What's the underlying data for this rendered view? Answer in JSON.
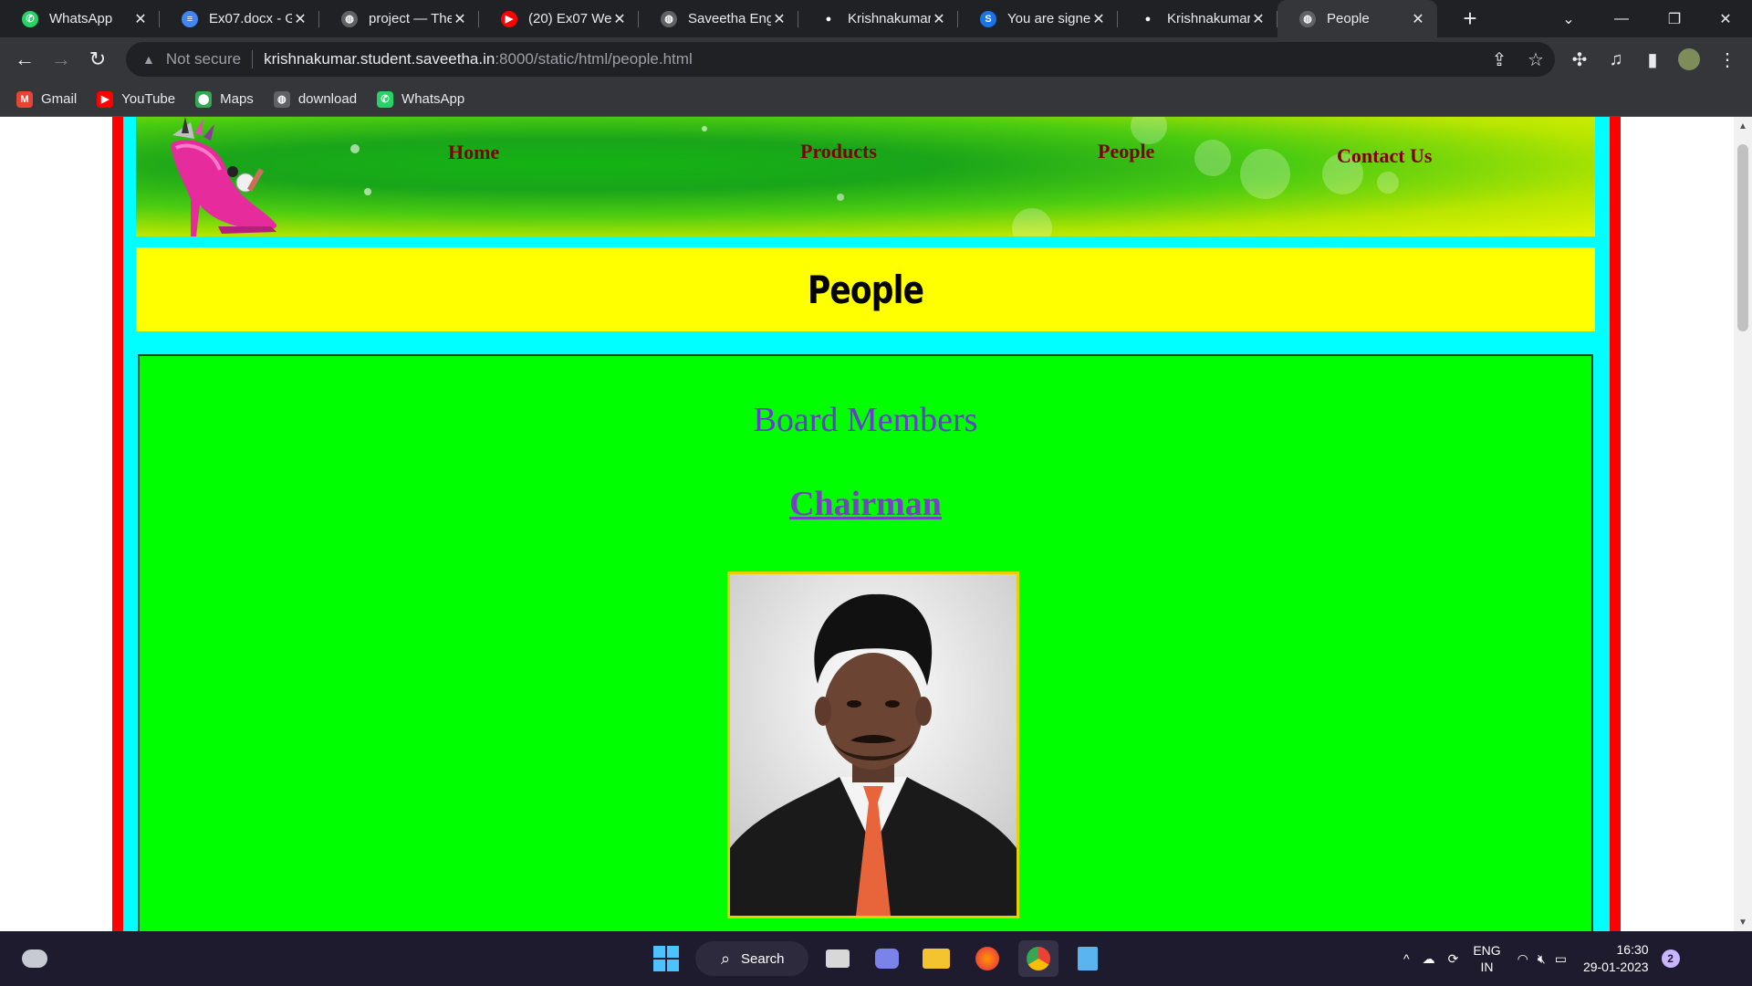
{
  "tabs": [
    {
      "title": "WhatsApp",
      "icon": "whatsapp-icon",
      "color": "#25d366",
      "glyph": "✆"
    },
    {
      "title": "Ex07.docx - Go",
      "icon": "google-docs-icon",
      "color": "#4285f4",
      "glyph": "≡"
    },
    {
      "title": "project — The",
      "icon": "globe-icon",
      "color": "#5f6368",
      "glyph": "◍"
    },
    {
      "title": "(20) Ex07 Web",
      "icon": "youtube-icon",
      "color": "#ff0000",
      "glyph": "▶"
    },
    {
      "title": "Saveetha Engi",
      "icon": "globe-icon",
      "color": "#5f6368",
      "glyph": "◍"
    },
    {
      "title": "Krishnakumar",
      "icon": "github-icon",
      "color": "#202124",
      "glyph": "●"
    },
    {
      "title": "You are signed",
      "icon": "s-app-icon",
      "color": "#1a73e8",
      "glyph": "S"
    },
    {
      "title": "Krishnakumar",
      "icon": "github-icon",
      "color": "#202124",
      "glyph": "●"
    },
    {
      "title": "People",
      "icon": "globe-icon",
      "color": "#5f6368",
      "glyph": "◍",
      "active": true
    }
  ],
  "address": {
    "security_label": "Not secure",
    "host": "krishnakumar.student.saveetha.in",
    "path": ":8000/static/html/people.html"
  },
  "bookmarks": [
    {
      "label": "Gmail",
      "icon": "gmail-icon",
      "color": "#ea4335",
      "glyph": "M"
    },
    {
      "label": "YouTube",
      "icon": "youtube-icon",
      "color": "#ff0000",
      "glyph": "▶"
    },
    {
      "label": "Maps",
      "icon": "maps-icon",
      "color": "#34a853",
      "glyph": "⬤"
    },
    {
      "label": "download",
      "icon": "globe-icon",
      "color": "#5f6368",
      "glyph": "◍"
    },
    {
      "label": "WhatsApp",
      "icon": "whatsapp-icon",
      "color": "#25d366",
      "glyph": "✆"
    }
  ],
  "site": {
    "nav": {
      "home": "Home",
      "products": "Products",
      "people": "People",
      "contact": "Contact Us"
    },
    "page_title": "People",
    "section_title": "Board Members",
    "role_title": "Chairman"
  },
  "taskbar": {
    "search_label": "Search",
    "lang_top": "ENG",
    "lang_bottom": "IN",
    "time": "16:30",
    "date": "29-01-2023",
    "notification_count": "2"
  },
  "colors": {
    "frame_red": "#ff0000",
    "frame_cyan": "#00ffff",
    "title_bg": "#ffff00",
    "content_bg": "#00ff00",
    "nav_text": "#800000",
    "heading_purple": "#6a3bd0"
  }
}
